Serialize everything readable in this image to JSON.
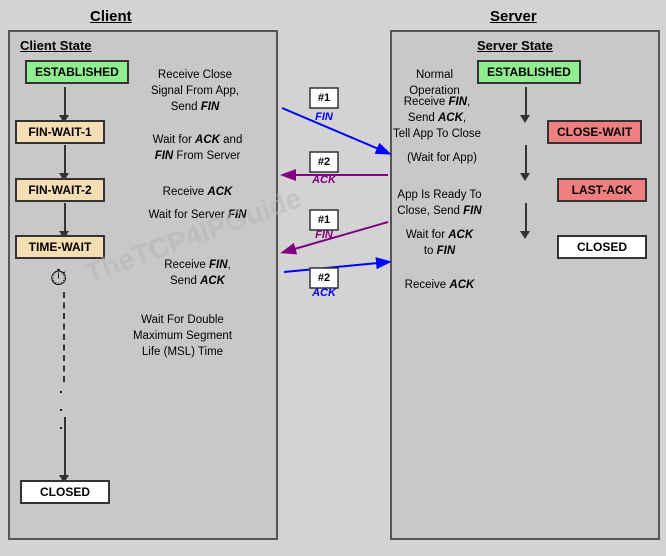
{
  "title": {
    "client": "Client",
    "server": "Server"
  },
  "client": {
    "section_title": "Client State",
    "states": {
      "established": "ESTABLISHED",
      "fin_wait_1": "FIN-WAIT-1",
      "fin_wait_2": "FIN-WAIT-2",
      "time_wait": "TIME-WAIT",
      "closed": "CLOSED"
    },
    "descriptions": {
      "d1": "Receive Close Signal From App, Send FIN",
      "d2": "Wait for ACK and FIN From Server",
      "d3": "Receive ACK",
      "d4": "Wait for Server FIN",
      "d5": "Receive FIN, Send ACK",
      "d6": "Wait For Double Maximum Segment Life (MSL) Time"
    }
  },
  "server": {
    "section_title": "Server State",
    "states": {
      "established": "ESTABLISHED",
      "close_wait": "CLOSE-WAIT",
      "last_ack": "LAST-ACK",
      "closed": "CLOSED"
    },
    "descriptions": {
      "d1": "Normal Operation",
      "d2": "Receive FIN, Send ACK, Tell App To Close",
      "d3": "(Wait for App)",
      "d4": "App Is Ready To Close, Send FIN",
      "d5": "Wait for ACK to FIN",
      "d6": "Receive ACK"
    }
  },
  "messages": {
    "fin1_label": "#1",
    "fin1_text": "FIN",
    "ack1_label": "#2",
    "ack1_text": "ACK",
    "fin2_label": "#1",
    "fin2_text": "FIN",
    "ack2_label": "#2",
    "ack2_text": "ACK"
  },
  "watermark": "TheTCP4IPGuide"
}
